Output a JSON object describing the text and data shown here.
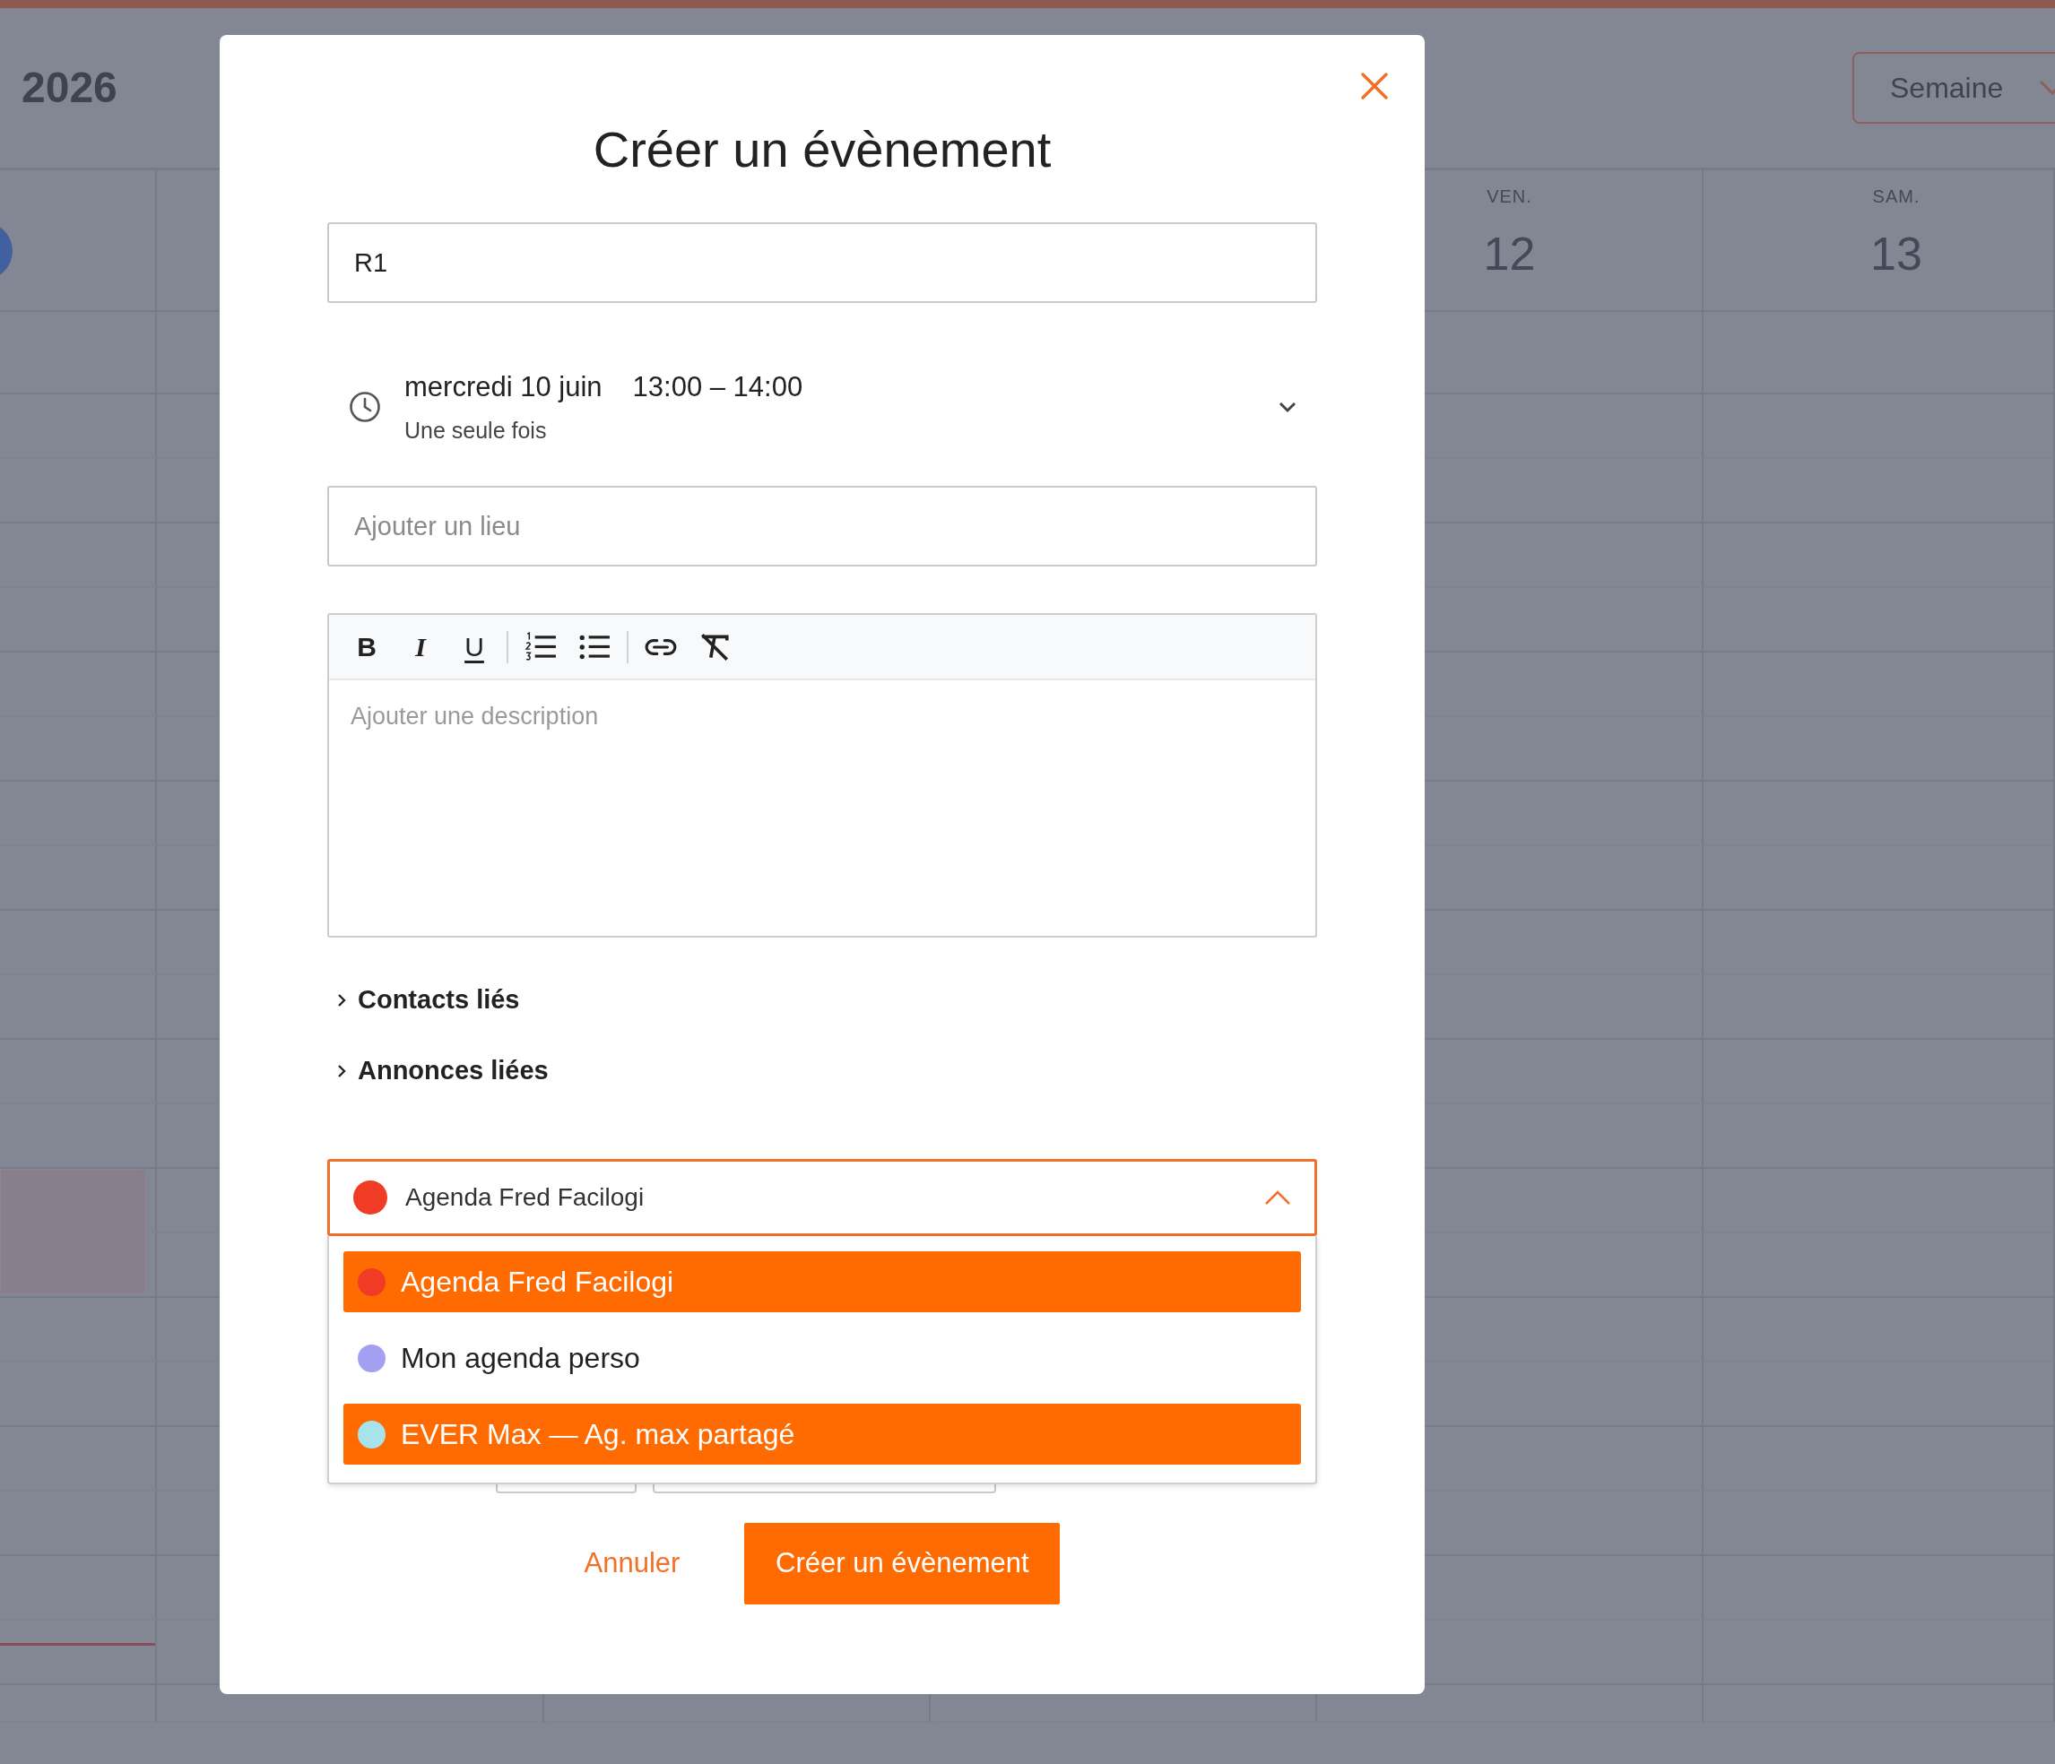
{
  "calendar": {
    "title": "2026",
    "view_button": "Semaine",
    "days": [
      {
        "weekday": "VEN.",
        "date": "12"
      },
      {
        "weekday": "SAM.",
        "date": "13"
      }
    ]
  },
  "dialog": {
    "title": "Créer un évènement",
    "title_field": {
      "value": "R1"
    },
    "when": {
      "date": "mercredi 10 juin",
      "time": "13:00 – 14:00",
      "recurrence": "Une seule fois"
    },
    "location_field": {
      "placeholder": "Ajouter un lieu"
    },
    "description_editor": {
      "placeholder": "Ajouter une description",
      "toolbar_groups": [
        {
          "tools": [
            {
              "kind": "bold",
              "label": "B"
            },
            {
              "kind": "italic",
              "label": "I"
            },
            {
              "kind": "underline",
              "label": "U"
            }
          ]
        },
        {
          "tools": [
            {
              "kind": "ordered-list"
            },
            {
              "kind": "bullet-list"
            }
          ]
        },
        {
          "tools": [
            {
              "kind": "link"
            },
            {
              "kind": "clear-format"
            }
          ]
        }
      ]
    },
    "sections": [
      {
        "label": "Contacts liés",
        "expanded": false
      },
      {
        "label": "Annonces liées",
        "expanded": false
      }
    ],
    "calendar_select": {
      "value": "Agenda Fred Facilogi",
      "color": "#f03c24",
      "expanded": true,
      "options": [
        {
          "label": "Agenda Fred Facilogi",
          "color": "#f03c24",
          "selected": true
        },
        {
          "label": "Mon agenda perso",
          "color": "#a3a0f2",
          "selected": false
        },
        {
          "label": "EVER Max — Ag. max partagé",
          "color": "#a6e3ea",
          "selected": true
        }
      ]
    },
    "buttons": [
      {
        "label": "Annuler",
        "kind": "link"
      },
      {
        "label": "Créer un évènement",
        "kind": "primary"
      }
    ]
  }
}
